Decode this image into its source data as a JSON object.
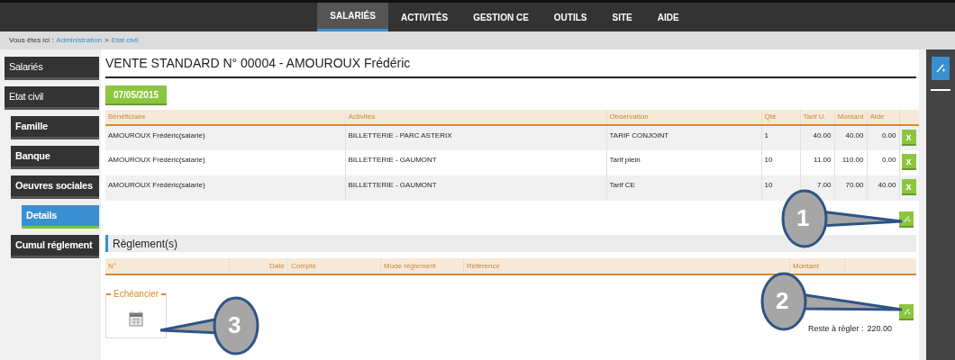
{
  "nav": {
    "tabs": [
      {
        "label": "SALARIÉS",
        "selected": true
      },
      {
        "label": "ACTIVITÉS",
        "selected": false
      },
      {
        "label": "GESTION CE",
        "selected": false
      },
      {
        "label": "OUTILS",
        "selected": false
      },
      {
        "label": "SITE",
        "selected": false
      },
      {
        "label": "AIDE",
        "selected": false
      }
    ]
  },
  "breadcrumb": {
    "prefix": "Vous êtes ici :",
    "links": [
      "Administration",
      "Etat civil"
    ],
    "separator": ">"
  },
  "sidebar": {
    "items": [
      {
        "label": "Salariés",
        "selected": false
      },
      {
        "label": "Etat civil",
        "selected": false,
        "children": [
          {
            "label": "Famille",
            "selected": false
          },
          {
            "label": "Banque",
            "selected": false
          },
          {
            "label": "Oeuvres sociales",
            "selected": false,
            "children": [
              {
                "label": "Details",
                "selected": true
              }
            ]
          },
          {
            "label": "Cumul réglement",
            "selected": false
          }
        ]
      }
    ]
  },
  "title": "VENTE STANDARD N° 00004 - AMOUROUX Frédéric",
  "date_button": "07/05/2015",
  "sales_table": {
    "columns": [
      "Bénéficiaire",
      "Activités",
      "Observation",
      "Qté",
      "Tarif U.",
      "Montant",
      "Aide"
    ],
    "rows": [
      {
        "cells": [
          "AMOUROUX Frédéric(salarie)",
          "BILLETTERIE - PARC ASTERIX",
          "TARIF CONJOINT",
          "1",
          "40.00",
          "40.00",
          "0.00"
        ],
        "delete": "x"
      },
      {
        "cells": [
          "AMOUROUX Frédéric(salarie)",
          "BILLETTERIE - GAUMONT",
          "Tarif plein",
          "10",
          "11.00",
          "110.00",
          "0.00"
        ],
        "delete": "x"
      },
      {
        "cells": [
          "AMOUROUX Frédéric(salarie)",
          "BILLETTERIE - GAUMONT",
          "Tarif CE",
          "10",
          "7.00",
          "70.00",
          "40.00"
        ],
        "delete": "x"
      }
    ]
  },
  "payments": {
    "title": "Règlement(s)",
    "columns": [
      "N°",
      "Date",
      "Compte",
      "Mode règlement",
      "Référence",
      "Montant"
    ]
  },
  "schedule": {
    "legend": "Echéancier"
  },
  "remaining": {
    "label": "Reste à règler :",
    "value": "220.00"
  },
  "callouts": [
    {
      "number": "1"
    },
    {
      "number": "2"
    },
    {
      "number": "3"
    }
  ]
}
